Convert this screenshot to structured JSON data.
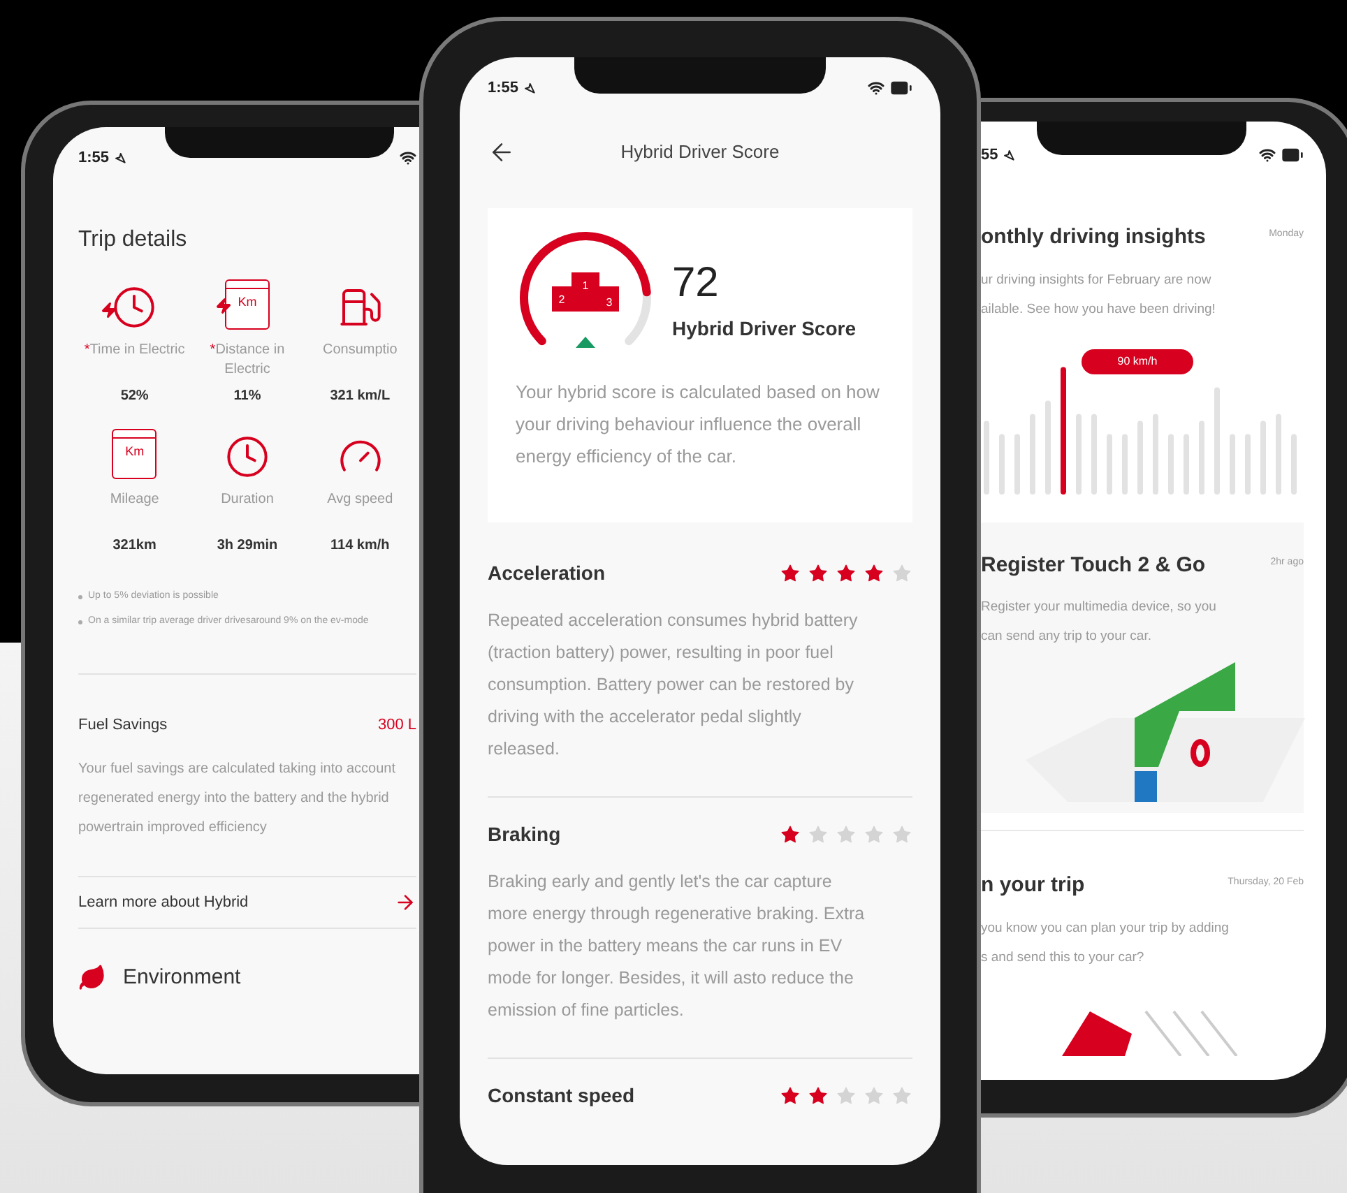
{
  "left_phone": {
    "status_time": "1:55",
    "title": "Trip details",
    "metrics": [
      {
        "kind": "clock",
        "electric": true,
        "mark": "*",
        "label": "Time in Electric",
        "value": "52%"
      },
      {
        "kind": "calendar",
        "electric": true,
        "badge": "Km",
        "mark": "*",
        "label": "Distance in Electric",
        "value": "11%"
      },
      {
        "kind": "fuel",
        "label": "Consumptio",
        "value": "321 km/L"
      },
      {
        "kind": "calendar",
        "electric": false,
        "badge": "Km",
        "label": "Mileage",
        "value": "321km"
      },
      {
        "kind": "clock",
        "electric": false,
        "label": "Duration",
        "value": "3h 29min"
      },
      {
        "kind": "speedometer",
        "label": "Avg speed",
        "value": "114 km/h"
      }
    ],
    "footnotes": [
      "Up to 5% deviation is possible",
      "On a similar trip average driver drivesaround 9% on the ev-mode"
    ],
    "fuel_savings": {
      "title": "Fuel Savings",
      "value": "300 L",
      "text": "Your fuel savings are calculated taking into account regenerated energy into the battery and the hybrid powertrain improved efficiency"
    },
    "link": "Learn more about Hybrid",
    "section": "Environment"
  },
  "center_phone": {
    "status_time": "1:55",
    "title": "Hybrid Driver Score",
    "score": {
      "value": "72",
      "label": "Hybrid Driver Score",
      "podium": [
        "2",
        "1",
        "3"
      ],
      "text": "Your hybrid score is calculated based on how your driving behaviour influence the overall energy efficiency of the car."
    },
    "ratings": [
      {
        "title": "Acceleration",
        "stars": 4,
        "text": "Repeated acceleration consumes hybrid battery (traction battery) power, resulting in poor fuel consumption. Battery power can be restored by driving with the accelerator pedal slightly released."
      },
      {
        "title": "Braking",
        "stars": 1,
        "text": "Braking early and gently let's the car capture more energy through regenerative braking. Extra power in the battery means the car runs in EV mode for longer. Besides, it will asto reduce the emission of fine particles."
      },
      {
        "title": "Constant speed",
        "stars": 2
      }
    ]
  },
  "right_phone": {
    "status_time": "55",
    "feed": [
      {
        "kind": "chart",
        "title": "onthly driving insights",
        "time": "Monday",
        "lines": [
          "ur driving insights for February are now",
          "ailable. See how you have been driving!"
        ],
        "tooltip": "90 km/h"
      },
      {
        "kind": "map",
        "title": "Register Touch 2 & Go",
        "time": "2hr ago",
        "lines": [
          "Register your multimedia device, so you",
          "can send any trip to your car."
        ]
      },
      {
        "kind": "route",
        "title": "n your trip",
        "time": "Thursday, 20 Feb",
        "lines": [
          "you know you can plan your trip by adding",
          "s and send this to your car?"
        ]
      }
    ]
  }
}
